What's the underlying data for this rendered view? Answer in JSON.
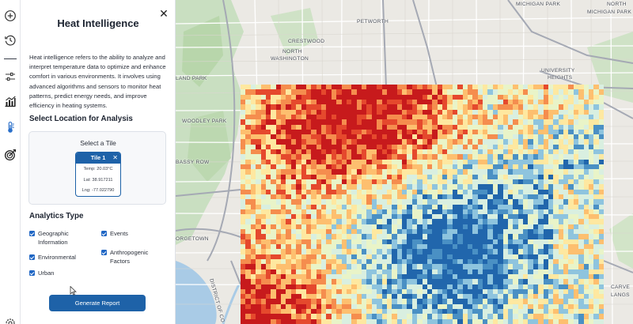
{
  "rail": {
    "items": [
      {
        "name": "add-icon"
      },
      {
        "name": "history-icon"
      },
      {
        "name": "filter-sliders-icon"
      },
      {
        "name": "bar-chart-icon"
      },
      {
        "name": "thermometer-icon"
      },
      {
        "name": "target-icon"
      },
      {
        "name": "gear-icon"
      }
    ]
  },
  "panel": {
    "title": "Heat Intelligence",
    "description": "Heat intelligence refers to the ability to analyze and interpret temperature data to optimize and enhance comfort in various environments. It involves using advanced algorithms and sensors to monitor heat patterns, predict energy needs, and improve efficiency in heating systems.",
    "location_section_title": "Select Location for Analysis",
    "tile_box_title": "Select a Tile",
    "tile": {
      "title": "Tile 1",
      "temp": "Temp: 20.03°C",
      "lat": "Lat: 38.917211",
      "lng": "Lng: -77.022790"
    },
    "analytics_title": "Analytics Type",
    "analytics": {
      "geographic": "Geographic Information",
      "events": "Events",
      "environmental": "Environmental",
      "anthropogenic": "Anthropogenic Factors",
      "urban": "Urban"
    },
    "generate_label": "Generate Report"
  },
  "map": {
    "labels": {
      "michigan_park": "MICHIGAN PARK",
      "north_michigan_park_1": "NORTH",
      "north_michigan_park_2": "MICHIGAN PARK",
      "petworth": "PETWORTH",
      "crestwood": "CRESTWOOD",
      "north_washington_1": "NORTH",
      "north_washington_2": "WASHINGTON",
      "land_park": "LAND PARK",
      "university_heights_1": "UNIVERSITY",
      "university_heights_2": "HEIGHTS",
      "woodley_park": "WOODLEY PARK",
      "bassy_row": "BASSY ROW",
      "georgetown": "ORGETOWN",
      "carver_langston_1": "CARVE",
      "carver_langston_2": "LANGS",
      "district": "DISTRICT OF CO"
    },
    "heat_colors": [
      "#2166ac",
      "#4a90c4",
      "#8ec4de",
      "#d9efe0",
      "#e9f4c8",
      "#fee8a0",
      "#fdbf6f",
      "#f58d4e",
      "#e5492d",
      "#c71a1c"
    ]
  }
}
